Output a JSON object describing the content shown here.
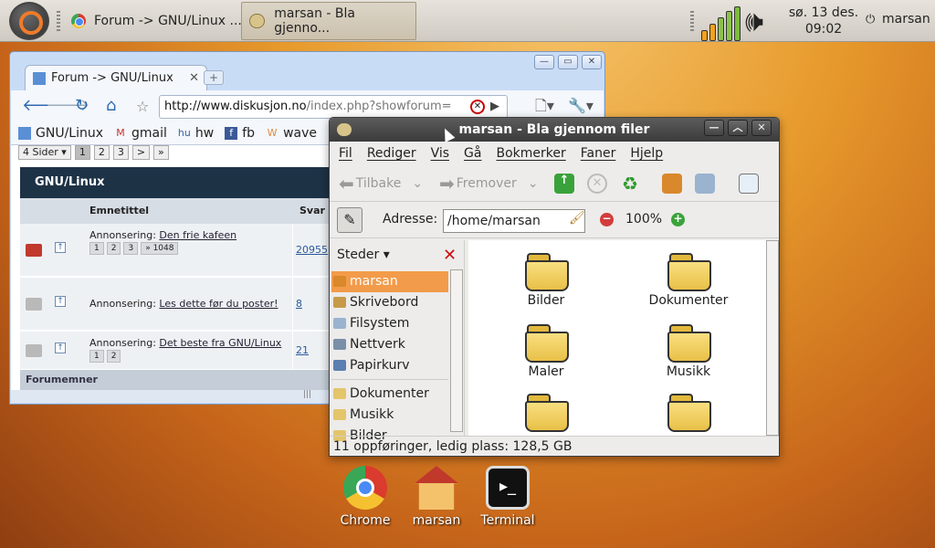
{
  "panel": {
    "tasks": [
      "Forum -> GNU/Linux ...",
      "marsan - Bla gjenno..."
    ],
    "clock": {
      "day": "sø. 13 des.",
      "time": "09:02"
    },
    "user": "marsan"
  },
  "chrome": {
    "tab": "Forum -> GNU/Linux",
    "url_host": "http://www.diskusjon.no",
    "url_path": "/index.php?showforum=",
    "bookmarks": [
      "GNU/Linux",
      "gmail",
      "hw",
      "fb",
      "wave"
    ],
    "pager": [
      "4 Sider ▾",
      "1",
      "2",
      "3",
      ">",
      "»"
    ],
    "forum_title": "GNU/Linux",
    "columns": [
      "Emnetittel",
      "Svar"
    ],
    "rows": [
      {
        "prefix": "Annonsering:",
        "title": "Den frie kafeen",
        "pages": [
          "1",
          "2",
          "3",
          "» 1048"
        ],
        "replies": "20955"
      },
      {
        "prefix": "Annonsering:",
        "title": "Les dette før du poster!",
        "pages": [],
        "replies": "8"
      },
      {
        "prefix": "Annonsering:",
        "title": "Det beste fra GNU/Linux",
        "pages": [
          "1",
          "2"
        ],
        "replies": "21"
      }
    ],
    "footer": "Forumemner"
  },
  "nautilus": {
    "title": "marsan - Bla gjennom filer",
    "menu": [
      "Fil",
      "Rediger",
      "Vis",
      "Gå",
      "Bokmerker",
      "Faner",
      "Hjelp"
    ],
    "toolbar": {
      "back": "Tilbake",
      "forward": "Fremover"
    },
    "location_label": "Adresse:",
    "location_value": "/home/marsan",
    "zoom": "100%",
    "sidebar_header": "Steder",
    "places": [
      "marsan",
      "Skrivebord",
      "Filsystem",
      "Nettverk",
      "Papirkurv"
    ],
    "bookmarks": [
      "Dokumenter",
      "Musikk",
      "Bilder"
    ],
    "folders": [
      "Bilder",
      "Dokumenter",
      "Maler",
      "Musikk",
      "",
      ""
    ],
    "status": "11 oppføringer, ledig plass: 128,5 GB"
  },
  "desktop": [
    "Chrome",
    "marsan",
    "Terminal"
  ]
}
